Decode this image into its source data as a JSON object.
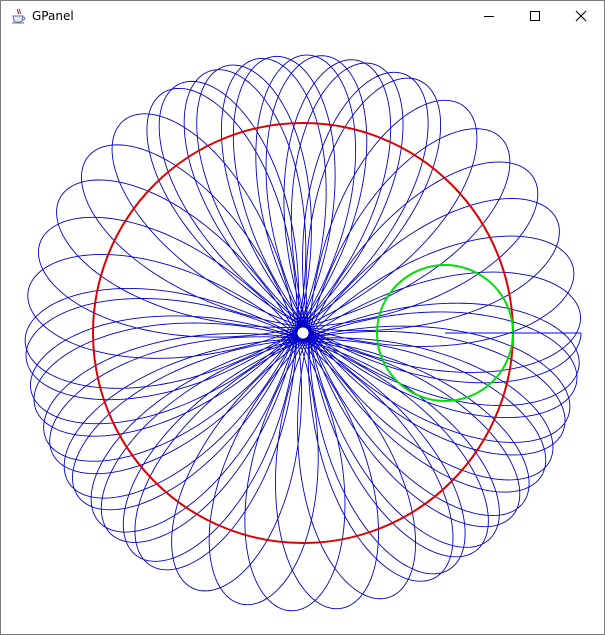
{
  "window": {
    "title": "GPanel",
    "icon": "java-cup-icon",
    "controls": {
      "minimize": "minimize-icon",
      "maximize": "maximize-icon",
      "close": "close-icon"
    }
  },
  "drawing": {
    "fixed_circle_color": "#e00000",
    "rolling_circle_color": "#00e000",
    "trace_color": "#0000c8",
    "pen_color": "#0000ff"
  }
}
